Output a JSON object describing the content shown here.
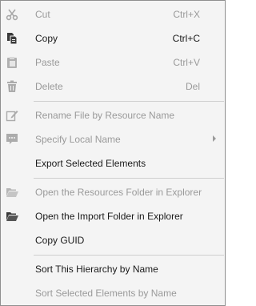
{
  "menu": {
    "items": [
      {
        "label": "Cut",
        "shortcut": "Ctrl+X",
        "icon": "scissors-icon",
        "enabled": false
      },
      {
        "label": "Copy",
        "shortcut": "Ctrl+C",
        "icon": "copy-icon",
        "enabled": true
      },
      {
        "label": "Paste",
        "shortcut": "Ctrl+V",
        "icon": "paste-icon",
        "enabled": false
      },
      {
        "label": "Delete",
        "shortcut": "Del",
        "icon": "trash-icon",
        "enabled": false
      },
      {
        "label": "Rename File by Resource Name",
        "icon": "rename-icon",
        "enabled": false
      },
      {
        "label": "Specify Local Name",
        "icon": "comment-icon",
        "enabled": false,
        "has_submenu": true
      },
      {
        "label": "Export Selected Elements",
        "enabled": true
      },
      {
        "label": "Open the Resources Folder in Explorer",
        "icon": "folder-open-icon",
        "enabled": false
      },
      {
        "label": "Open the Import Folder in Explorer",
        "icon": "folder-open-icon",
        "enabled": true
      },
      {
        "label": "Copy GUID",
        "enabled": true
      },
      {
        "label": "Sort This Hierarchy by Name",
        "enabled": true
      },
      {
        "label": "Sort Selected Elements by Name",
        "enabled": false
      }
    ]
  },
  "colors": {
    "background": "#f4f4f4",
    "text_enabled": "#1a1a1a",
    "text_disabled": "#9a9a9a",
    "separator": "#cfcfcf",
    "border": "#8f8f8f"
  }
}
